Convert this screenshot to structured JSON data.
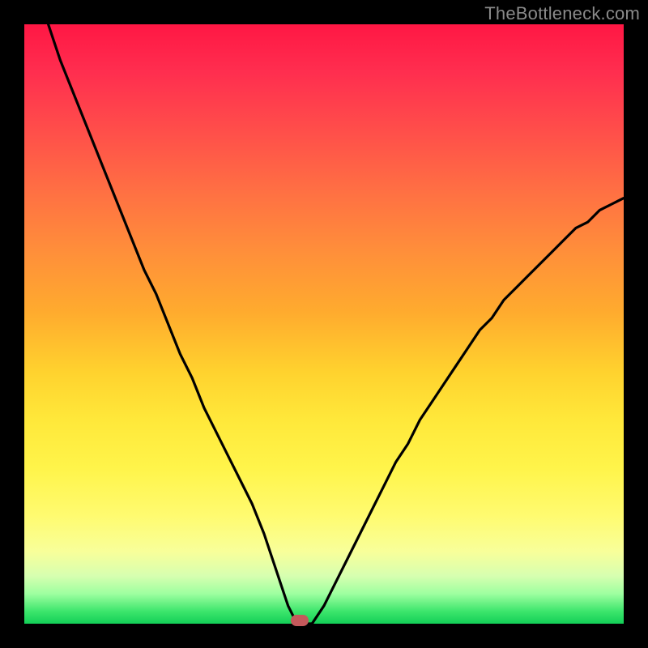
{
  "watermark": "TheBottleneck.com",
  "colors": {
    "frame": "#000000",
    "curve": "#000000",
    "marker": "#c4595b"
  },
  "chart_data": {
    "type": "line",
    "title": "",
    "xlabel": "",
    "ylabel": "",
    "xlim": [
      0,
      100
    ],
    "ylim": [
      0,
      100
    ],
    "x": [
      4,
      5,
      6,
      8,
      10,
      12,
      14,
      16,
      18,
      20,
      22,
      24,
      26,
      28,
      30,
      32,
      34,
      36,
      38,
      40,
      41,
      42,
      43,
      44,
      45,
      46,
      48,
      50,
      52,
      54,
      56,
      58,
      60,
      62,
      64,
      66,
      68,
      70,
      72,
      74,
      76,
      78,
      80,
      82,
      84,
      86,
      88,
      90,
      92,
      94,
      96,
      98,
      100
    ],
    "values": [
      100,
      97,
      94,
      89,
      84,
      79,
      74,
      69,
      64,
      59,
      55,
      50,
      45,
      41,
      36,
      32,
      28,
      24,
      20,
      15,
      12,
      9,
      6,
      3,
      1,
      0,
      0,
      3,
      7,
      11,
      15,
      19,
      23,
      27,
      30,
      34,
      37,
      40,
      43,
      46,
      49,
      51,
      54,
      56,
      58,
      60,
      62,
      64,
      66,
      67,
      69,
      70,
      71
    ],
    "minimum_x": 46,
    "legend": false,
    "grid": false,
    "annotations": []
  },
  "marker": {
    "x_percent": 46,
    "y_percent": 0
  }
}
